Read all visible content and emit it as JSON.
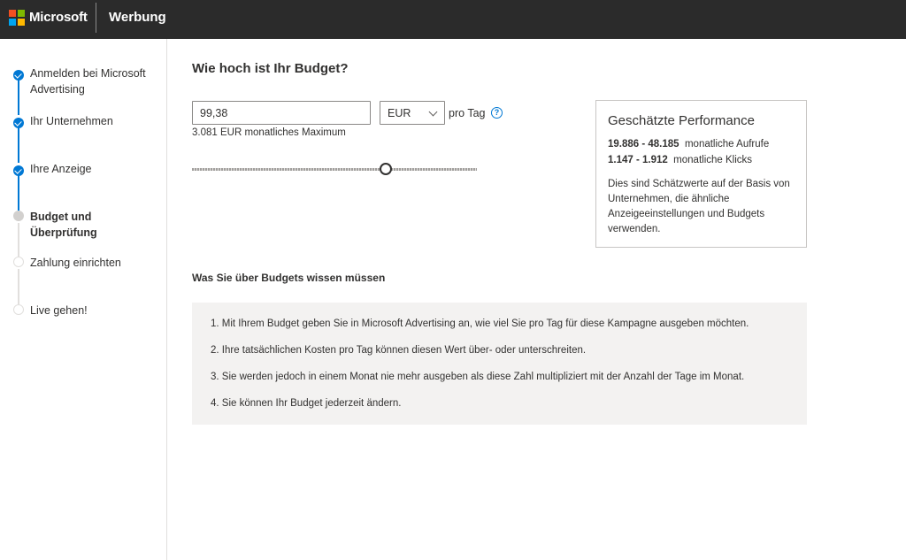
{
  "header": {
    "brand": "Microsoft",
    "product": "Werbung",
    "logo_colors": [
      "#f25022",
      "#7fba00",
      "#00a4ef",
      "#ffb900"
    ]
  },
  "sidebar": {
    "steps": [
      {
        "label": "Anmelden bei Microsoft Advertising",
        "state": "done"
      },
      {
        "label": "Ihr Unternehmen",
        "state": "done"
      },
      {
        "label": "Ihre Anzeige",
        "state": "done"
      },
      {
        "label": "Budget und Überprüfung",
        "state": "current"
      },
      {
        "label": "Zahlung einrichten",
        "state": "future"
      },
      {
        "label": "Live gehen!",
        "state": "future"
      }
    ],
    "accent_color": "#0078d4"
  },
  "budget": {
    "title": "Wie hoch ist Ihr Budget?",
    "amount": "99,38",
    "currency": "EUR",
    "per_day_label": "pro Tag",
    "help_glyph": "?",
    "monthly_max": "3.081 EUR monatliches Maximum",
    "slider_level": 0.68
  },
  "performance": {
    "title": "Geschätzte Performance",
    "views_range": "19.886 - 48.185",
    "views_label": "monatliche Aufrufe",
    "clicks_range": "1.147 - 1.912",
    "clicks_label": "monatliche Klicks",
    "note": "Dies sind Schätzwerte auf der Basis von Unternehmen, die ähnliche Anzeigeeinstellungen und Budgets verwenden."
  },
  "info": {
    "heading": "Was Sie über Budgets wissen müssen",
    "items": [
      "1. Mit Ihrem Budget geben Sie in Microsoft Advertising an, wie viel Sie pro Tag für diese Kampagne ausgeben möchten.",
      "2. Ihre tatsächlichen Kosten pro Tag können diesen Wert über- oder unterschreiten.",
      "3. Sie werden jedoch in einem Monat nie mehr ausgeben als diese Zahl multipliziert mit der Anzahl der Tage im Monat.",
      "4. Sie können Ihr Budget jederzeit ändern."
    ]
  }
}
